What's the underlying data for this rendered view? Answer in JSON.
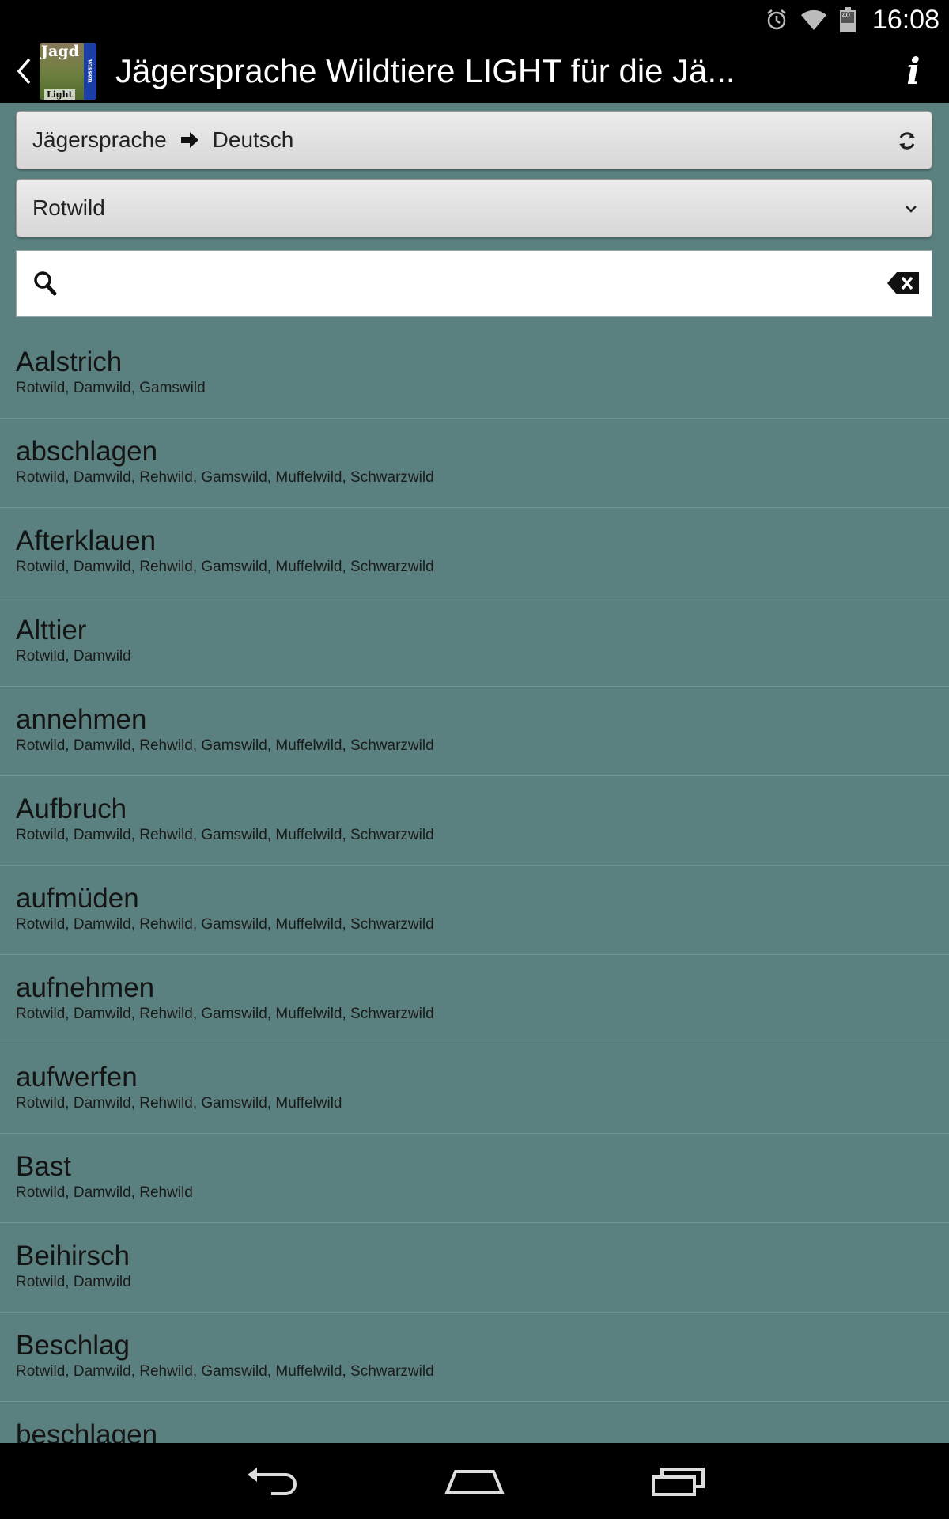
{
  "status_bar": {
    "time": "16:08",
    "battery_level": "40",
    "icons": [
      "alarm-icon",
      "wifi-icon",
      "battery-icon"
    ]
  },
  "action_bar": {
    "title": "Jägersprache Wildtiere LIGHT für die Jä...",
    "logo": {
      "top": "Jagd",
      "side": "wissen",
      "bottom": "Light"
    },
    "icons": [
      "back-icon",
      "info-icon"
    ]
  },
  "language_selector": {
    "from": "Jägersprache",
    "to": "Deutsch",
    "icon": "swap-icon"
  },
  "animal_selector": {
    "selected": "Rotwild",
    "icon": "chevron-down-icon"
  },
  "search": {
    "value": "",
    "placeholder": ""
  },
  "entries": [
    {
      "term": "Aalstrich",
      "species": "Rotwild, Damwild, Gamswild"
    },
    {
      "term": "abschlagen",
      "species": "Rotwild, Damwild, Rehwild, Gamswild, Muffelwild, Schwarzwild"
    },
    {
      "term": "Afterklauen",
      "species": "Rotwild, Damwild, Rehwild, Gamswild, Muffelwild, Schwarzwild"
    },
    {
      "term": "Alttier",
      "species": "Rotwild, Damwild"
    },
    {
      "term": "annehmen",
      "species": "Rotwild, Damwild, Rehwild, Gamswild, Muffelwild, Schwarzwild"
    },
    {
      "term": "Aufbruch",
      "species": "Rotwild, Damwild, Rehwild, Gamswild, Muffelwild, Schwarzwild"
    },
    {
      "term": "aufmüden",
      "species": "Rotwild, Damwild, Rehwild, Gamswild, Muffelwild, Schwarzwild"
    },
    {
      "term": "aufnehmen",
      "species": "Rotwild, Damwild, Rehwild, Gamswild, Muffelwild, Schwarzwild"
    },
    {
      "term": "aufwerfen",
      "species": "Rotwild, Damwild, Rehwild, Gamswild, Muffelwild"
    },
    {
      "term": "Bast",
      "species": "Rotwild, Damwild, Rehwild"
    },
    {
      "term": "Beihirsch",
      "species": "Rotwild, Damwild"
    },
    {
      "term": "Beschlag",
      "species": "Rotwild, Damwild, Rehwild, Gamswild, Muffelwild, Schwarzwild"
    },
    {
      "term": "beschlagen",
      "species": ""
    }
  ],
  "nav_bar": {
    "icons": [
      "back-nav-icon",
      "home-icon",
      "recents-icon"
    ]
  },
  "colors": {
    "list_background": "#5a817f",
    "bar_background": "#000000",
    "divider": "#6f9593"
  }
}
